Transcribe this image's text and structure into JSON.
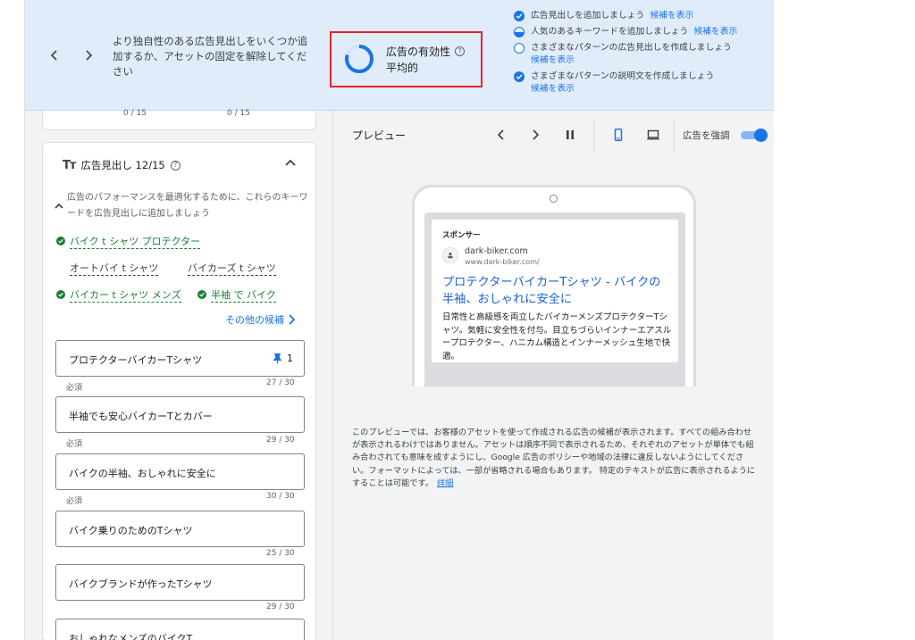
{
  "banner": {
    "message": "より独自性のある広告見出しをいくつか追加するか、アセットの固定を解除してください",
    "strength_title": "広告の有効性",
    "strength_value": "平均的",
    "strength_fraction": 0.8,
    "suggestions": [
      {
        "text": "広告見出しを追加しましょう",
        "link": "候補を表示",
        "status": "done"
      },
      {
        "text": "人気のあるキーワードを追加しましょう",
        "link": "候補を表示",
        "status": "half"
      },
      {
        "text": "さまざまなパターンの広告見出しを作成しましょう",
        "link": "候補を表示",
        "status": "empty"
      },
      {
        "text": "さまざまなパターンの説明文を作成しましょう",
        "link": "候補を表示",
        "status": "done"
      }
    ]
  },
  "editor": {
    "prev_counter_1": "0 / 15",
    "prev_counter_2": "0 / 15",
    "headlines_title": "広告見出し 12/15",
    "hint": "広告のパフォーマンスを最適化するために、これらのキーワードを広告見出しに追加しましょう",
    "keywords": [
      {
        "label": "バイク t シャツ プロテクター",
        "added": true
      },
      {
        "label": "オートバイ t シャツ",
        "added": false
      },
      {
        "label": "バイカーズ t シャツ",
        "added": false
      },
      {
        "label": "バイカー t シャツ メンズ",
        "added": true
      },
      {
        "label": "半袖 で バイク",
        "added": true
      }
    ],
    "more_link": "その他の候補",
    "headlines": [
      {
        "value": "プロテクターバイカーTシャツ",
        "pin": "1",
        "label": "必須",
        "count": "27 / 30"
      },
      {
        "value": "半袖でも安心バイカーTとカバー",
        "label": "必須",
        "count": "29 / 30"
      },
      {
        "value": "バイクの半袖、おしゃれに安全に",
        "label": "必須",
        "count": "30 / 30"
      },
      {
        "value": "バイク乗りのためのTシャツ",
        "label": "",
        "count": "25 / 30"
      },
      {
        "value": "バイクブランドが作ったTシャツ",
        "label": "",
        "count": "29 / 30"
      },
      {
        "value": "おしゃれなメンズのバイクT",
        "label": "",
        "count": ""
      }
    ]
  },
  "preview": {
    "title": "プレビュー",
    "emphasize_label": "広告を強調",
    "emphasize_on": true,
    "ad": {
      "sponsor": "スポンサー",
      "domain": "dark-biker.com",
      "url": "www.dark-biker.com/",
      "headline": "プロテクターバイカーTシャツ - バイクの半袖、おしゃれに安全に",
      "description": "日常性と高級感を両立したバイカーメンズプロテクターTシャツ。気軽に安全性を付与。目立ちづらいインナーエアスループロテクター、ハニカム構造とインナーメッシュ生地で快適。"
    },
    "disclaimer": "このプレビューでは、お客様のアセットを使って作成される広告の候補が表示されます。すべての組み合わせが表示されるわけではありません。アセットは順序不同で表示されるため、それぞれのアセットが単体でも組み合わされても意味を成すようにし、Google 広告のポリシーや地域の法律に違反しないようにしてください。フォーマットによっては、一部が省略される場合もあります。 特定のテキストが広告に表示されるようにすることは可能です。",
    "details_link": "詳細"
  },
  "colors": {
    "accent": "#1a73e8",
    "banner_bg": "#e1ecfb",
    "highlight_box": "#e8232a",
    "added_keyword": "#188038"
  }
}
